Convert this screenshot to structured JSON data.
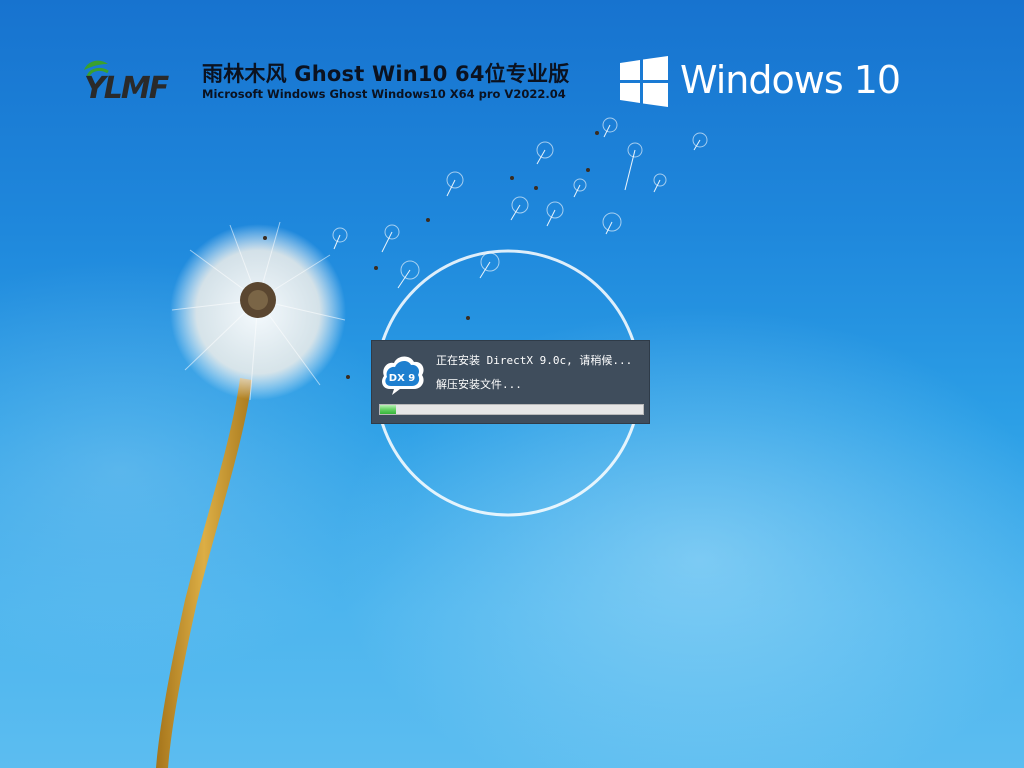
{
  "branding": {
    "logo_text": "YLMF",
    "title": "雨林木风 Ghost Win10 64位专业版",
    "subtitle": "Microsoft Windows Ghost Windows10 X64 pro V2022.04"
  },
  "os_logo": {
    "text": "Windows 10",
    "icon": "windows-flag-icon"
  },
  "install_dialog": {
    "icon_text": "DX 9",
    "icon": "directx-cloud-icon",
    "status_line": "正在安装 DirectX 9.0c, 请稍候...",
    "detail_line": "解压安装文件...",
    "progress_fraction": 0.06
  },
  "colors": {
    "sky_top": "#1773cf",
    "sky_bottom": "#5cbdf0",
    "dialog_bg": "#3f4d5c",
    "progress_green": "#35b43a",
    "logo_green": "#3aa02e",
    "stem": "#c9962a"
  }
}
